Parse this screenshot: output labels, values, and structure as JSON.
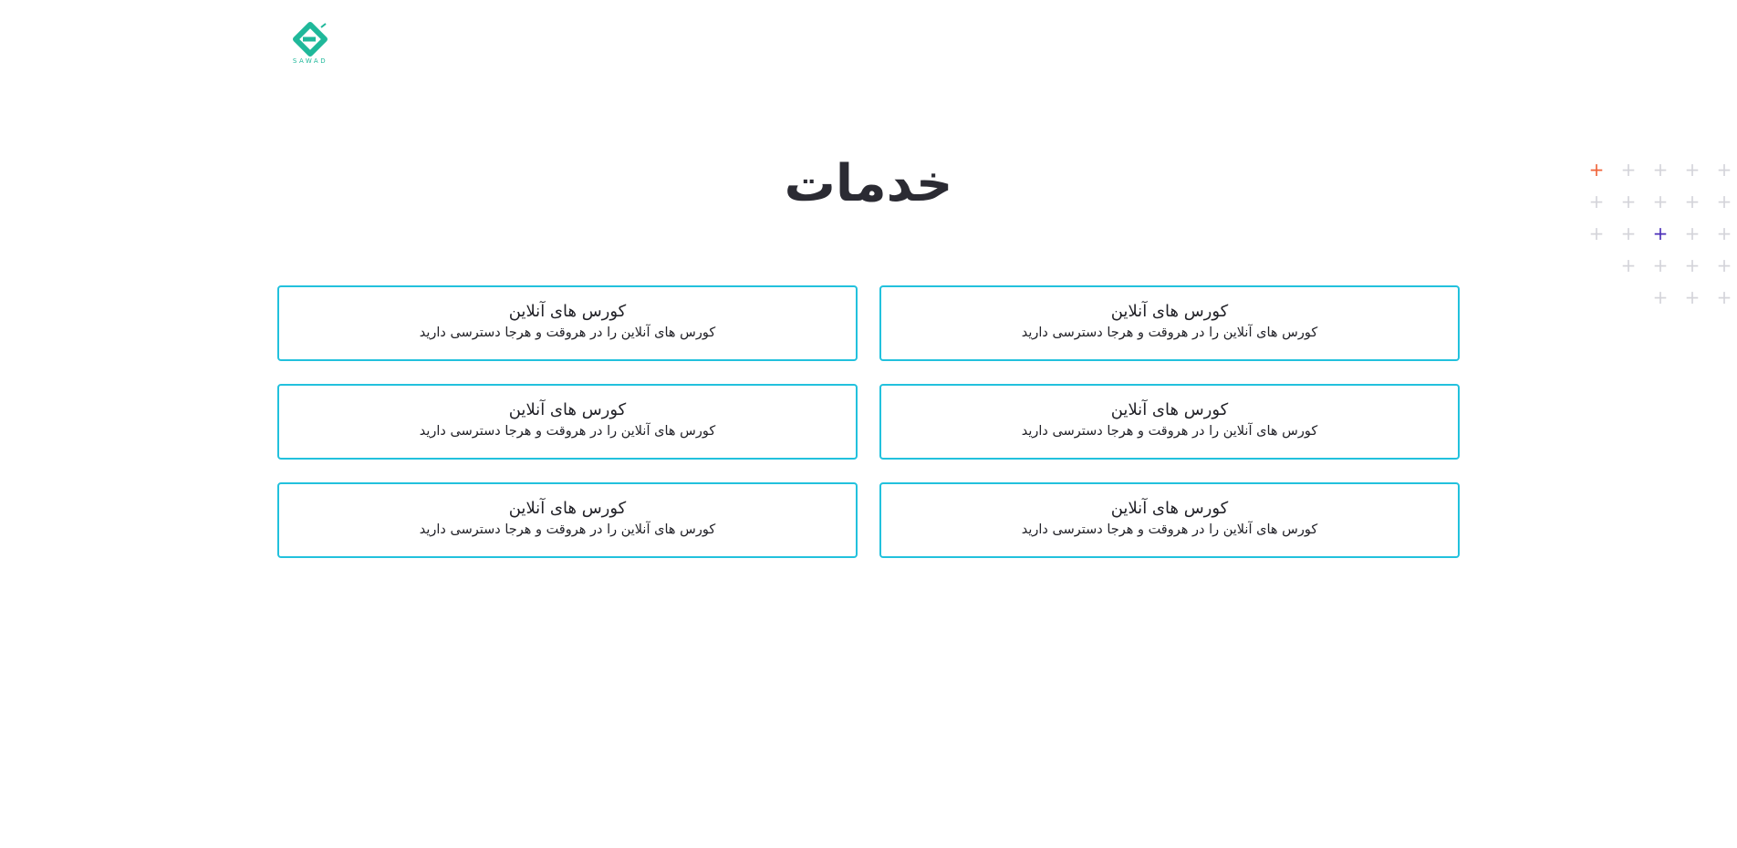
{
  "brand": {
    "name": "SAWAD",
    "logo_icon": "sawad-logo-icon",
    "color": "#1fb89a"
  },
  "page": {
    "title": "خدمات"
  },
  "services": [
    {
      "title": "کورس های آنلاین",
      "description": "کورس های آنلاین را در هروقت و هرجا دسترسی دارید"
    },
    {
      "title": "کورس های آنلاین",
      "description": "کورس های آنلاین را در هروقت و هرجا دسترسی دارید"
    },
    {
      "title": "کورس های آنلاین",
      "description": "کورس های آنلاین را در هروقت و هرجا دسترسی دارید"
    },
    {
      "title": "کورس های آنلاین",
      "description": "کورس های آنلاین را در هروقت و هرجا دسترسی دارید"
    },
    {
      "title": "کورس های آنلاین",
      "description": "کورس های آنلاین را در هروقت و هرجا دسترسی دارید"
    },
    {
      "title": "کورس های آنلاین",
      "description": "کورس های آنلاین را در هروقت و هرجا دسترسی دارید"
    }
  ],
  "decoration": {
    "icon": "plus-icon",
    "colors": {
      "default": "#d4d4da",
      "accent_orange": "#f0643a",
      "accent_purple": "#4b2fb8"
    }
  },
  "theme": {
    "card_border": "#22c1dd",
    "text": "#2b2b33"
  }
}
